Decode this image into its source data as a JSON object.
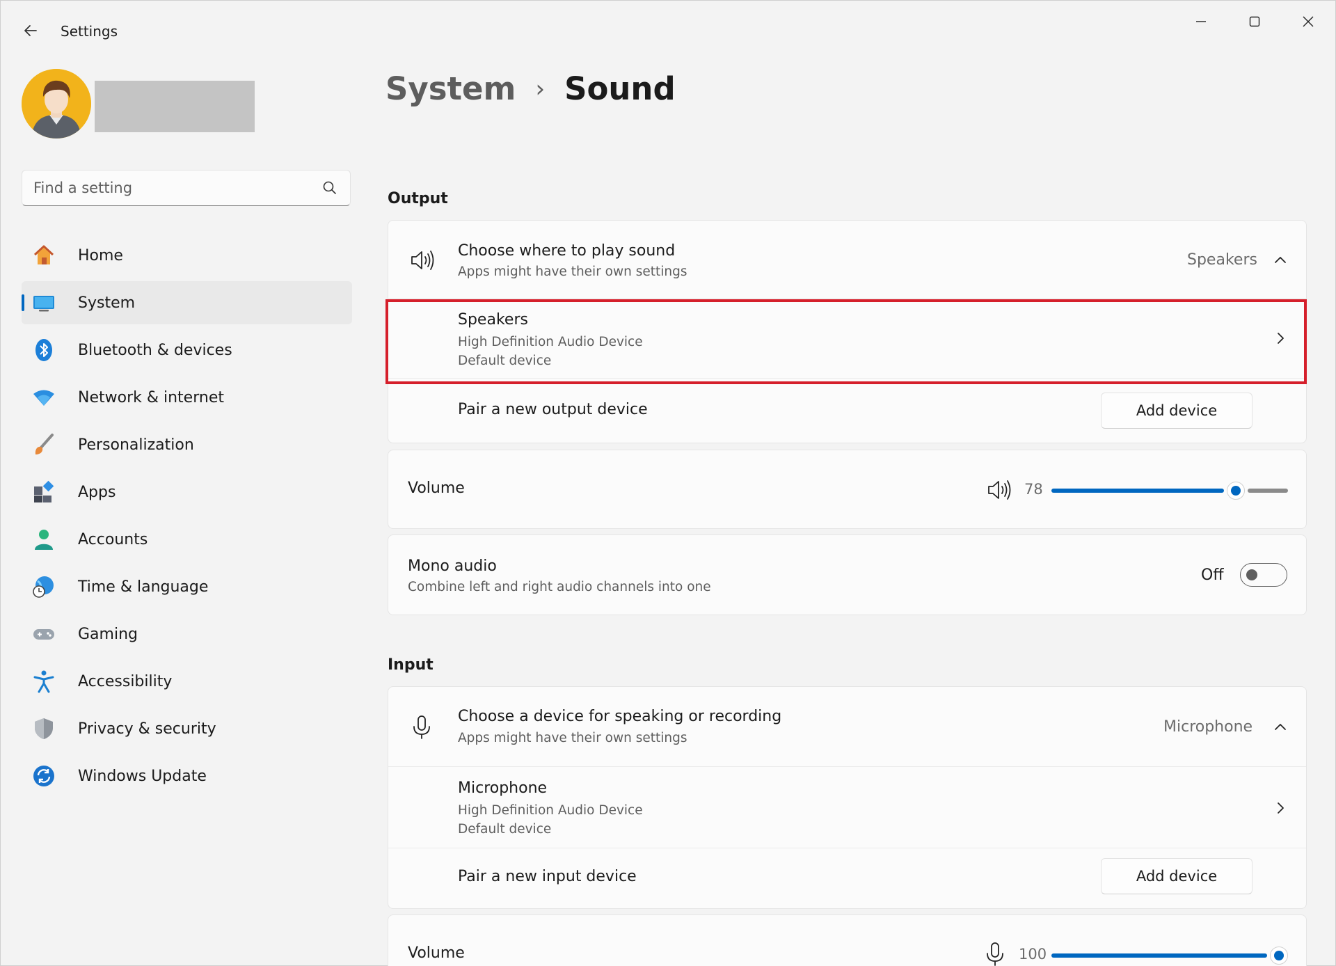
{
  "window": {
    "title": "Settings",
    "controls": [
      "minimize",
      "maximize",
      "close"
    ]
  },
  "search": {
    "placeholder": "Find a setting"
  },
  "sidebar": {
    "items": [
      {
        "label": "Home",
        "icon": "home-icon"
      },
      {
        "label": "System",
        "icon": "system-icon",
        "active": true
      },
      {
        "label": "Bluetooth & devices",
        "icon": "bluetooth-icon"
      },
      {
        "label": "Network & internet",
        "icon": "wifi-icon"
      },
      {
        "label": "Personalization",
        "icon": "brush-icon"
      },
      {
        "label": "Apps",
        "icon": "apps-icon"
      },
      {
        "label": "Accounts",
        "icon": "accounts-icon"
      },
      {
        "label": "Time & language",
        "icon": "globe-clock-icon"
      },
      {
        "label": "Gaming",
        "icon": "gamepad-icon"
      },
      {
        "label": "Accessibility",
        "icon": "accessibility-icon"
      },
      {
        "label": "Privacy & security",
        "icon": "shield-icon"
      },
      {
        "label": "Windows Update",
        "icon": "update-icon"
      }
    ]
  },
  "breadcrumb": {
    "parent": "System",
    "separator": "›",
    "current": "Sound"
  },
  "output": {
    "section_title": "Output",
    "choose": {
      "title": "Choose where to play sound",
      "subtitle": "Apps might have their own settings",
      "value": "Speakers"
    },
    "device": {
      "title": "Speakers",
      "line1": "High Definition Audio Device",
      "line2": "Default device"
    },
    "pair": {
      "label": "Pair a new output device",
      "button": "Add device"
    },
    "volume": {
      "label": "Volume",
      "value": "78",
      "fraction": 0.78
    },
    "mono": {
      "title": "Mono audio",
      "subtitle": "Combine left and right audio channels into one",
      "state": "Off"
    }
  },
  "input": {
    "section_title": "Input",
    "choose": {
      "title": "Choose a device for speaking or recording",
      "subtitle": "Apps might have their own settings",
      "value": "Microphone"
    },
    "device": {
      "title": "Microphone",
      "line1": "High Definition Audio Device",
      "line2": "Default device"
    },
    "pair": {
      "label": "Pair a new input device",
      "button": "Add device"
    },
    "volume": {
      "label": "Volume",
      "value": "100",
      "fraction": 1.0
    }
  },
  "colors": {
    "accent": "#0067c0",
    "highlight": "#d51f2b",
    "background": "#f3f3f3",
    "card": "#fbfbfb"
  }
}
